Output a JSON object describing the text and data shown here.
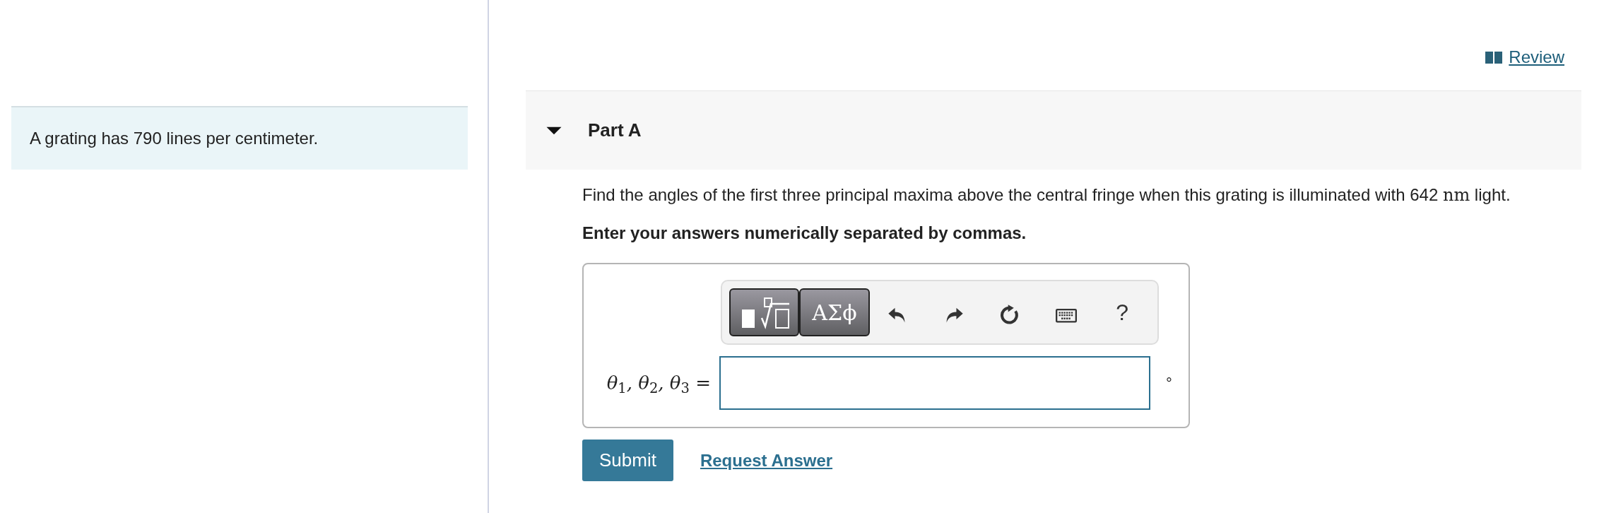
{
  "problem_statement": "A grating has 790 lines per centimeter.",
  "review_link": "Review",
  "part": {
    "title": "Part A",
    "expanded": true
  },
  "question": {
    "text": "Find the angles of the first three principal maxima above the central fringe when this grating is illuminated with 642",
    "unit": "nm",
    "tail": "light."
  },
  "instruction": "Enter your answers numerically separated by commas.",
  "toolbar": [
    {
      "kind": "templates"
    },
    {
      "kind": "symbols",
      "label": "ΑΣϕ"
    },
    {
      "kind": "undo"
    },
    {
      "kind": "redo"
    },
    {
      "kind": "reset"
    },
    {
      "kind": "keyboard"
    },
    {
      "kind": "help",
      "label": "?"
    }
  ],
  "answer": {
    "label": "θ$_{1}$, θ$_{2}$, θ$_{3}$ =",
    "unit": "°"
  },
  "buttons": {
    "submit": "Submit",
    "request": "Request Answer"
  }
}
